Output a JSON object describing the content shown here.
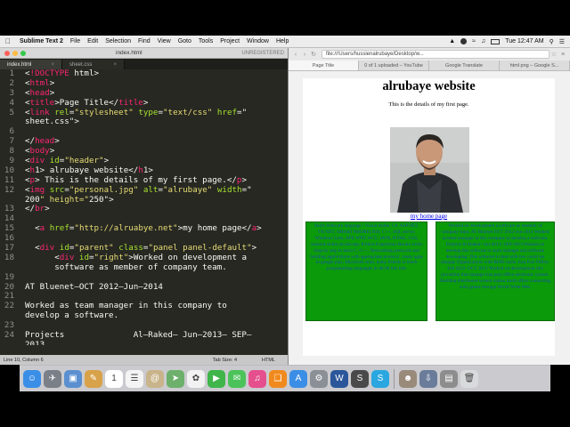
{
  "menubar": {
    "app": "Sublime Text 2",
    "menus": [
      "File",
      "Edit",
      "Selection",
      "Find",
      "View",
      "Goto",
      "Tools",
      "Project",
      "Window",
      "Help"
    ],
    "clock": "Tue 12:47 AM"
  },
  "sublime": {
    "window_title": "index.html",
    "unregistered": "UNREGISTERED",
    "tabs": [
      {
        "label": "index.html",
        "active": true
      },
      {
        "label": "sheet.css",
        "active": false
      }
    ],
    "status_left": "Line 10, Column 6",
    "tab_size": "Tab Size: 4",
    "syntax": "HTML"
  },
  "code": {
    "lines": [
      {
        "n": "1",
        "t": "<!DOCTYPE html>"
      },
      {
        "n": "2",
        "t": "<html>"
      },
      {
        "n": "3",
        "t": "<head>"
      },
      {
        "n": "4",
        "t": "<title>Page Title</title>"
      },
      {
        "n": "5",
        "t": "<link rel=\"stylesheet\" type=\"text/css\" href=\""
      },
      {
        "n": "",
        "t": "sheet.css\">"
      },
      {
        "n": "6",
        "t": ""
      },
      {
        "n": "7",
        "t": "</head>"
      },
      {
        "n": "8",
        "t": "<body>"
      },
      {
        "n": "9",
        "t": "<div id=\"header\">"
      },
      {
        "n": "10",
        "t": "<h1> alrubaye website</h1>"
      },
      {
        "n": "11",
        "t": "<p> This is the details of my first page.</p>"
      },
      {
        "n": "12",
        "t": "<img src=\"personal.jpg\" alt=\"alrubaye\" width=\""
      },
      {
        "n": "",
        "t": "200\" height=\"250\">"
      },
      {
        "n": "13",
        "t": "</br>"
      },
      {
        "n": "14",
        "t": ""
      },
      {
        "n": "15",
        "t": "  <a href=\"http://alruabye.net\">my home page</a>"
      },
      {
        "n": "16",
        "t": ""
      },
      {
        "n": "17",
        "t": "  <div id=\"parent\" class=\"panel panel-default\">"
      },
      {
        "n": "18",
        "t": "      <div id=\"right\">Worked on development a"
      },
      {
        "n": "",
        "t": "      software as member of company team."
      },
      {
        "n": "19",
        "t": ""
      },
      {
        "n": "20",
        "t": "AT Bluenet–OCT 2012–Jun–2014"
      },
      {
        "n": "21",
        "t": ""
      },
      {
        "n": "22",
        "t": "Worked as team manager in this company to"
      },
      {
        "n": "",
        "t": "develop a software."
      },
      {
        "n": "23",
        "t": ""
      },
      {
        "n": "24",
        "t": "Projects              Al–Raked– Jun–2013– SEP–"
      },
      {
        "n": "",
        "t": "2013"
      }
    ]
  },
  "browser": {
    "url": "file:///Users/hussienalrubaye/Desktop/w...",
    "tabs": [
      "Page Title",
      "0 of 1 uploaded – YouTube",
      "Google Translate",
      "html png – Google S..."
    ],
    "page": {
      "h1": "alrubaye website",
      "p": "This is the details of my first page.",
      "link": "my home page",
      "left_panel": "Skills Software language : Visual studio, C#, ASP.NET, VB.NET, SMART PHONE( IOS, C++, SQL server, Windows form, APP, WPF, WCF, JAVA, HTML, CSS, android studio,JavaScript, Python Experience Books wrote Step-by step to learn C, C++, Networking protocols and building applications with appropriate protocol , many apps in google play, Microsoft store, many friends to teach programming languages in 48-96 this link",
      "right_panel": "Worked on development a software as member of company team. AT Bluenet-OCT 2012-Jun-2014 Worked as team manager in this company to develop a software. Projects Al-Raked- Jun-2013- SEP-2013 Worked on develop this software to store manager and software developing. This software is deal with low could we manage Organizations with RFID cards. Iraq Post Office- Feb 2012- OCT 2012 Worked on development this procedure that manage Iraq post office electronic system. Building distributed system makes multi office connecting with gather through World Wide Web."
    }
  },
  "dock": {
    "items": [
      {
        "icon": "finder-icon",
        "color": "#3a8ee6"
      },
      {
        "icon": "launchpad-icon",
        "color": "#7a7f88"
      },
      {
        "icon": "preview-icon",
        "color": "#5b8fd0"
      },
      {
        "icon": "notes-icon",
        "color": "#d8a24a"
      },
      {
        "icon": "calendar-icon",
        "color": "#ffffff"
      },
      {
        "icon": "reminders-icon",
        "color": "#f4f4f4"
      },
      {
        "icon": "contacts-icon",
        "color": "#c9b38a"
      },
      {
        "icon": "maps-icon",
        "color": "#6db06b"
      },
      {
        "icon": "photos-icon",
        "color": "#f2f2f2"
      },
      {
        "icon": "facetime-icon",
        "color": "#3fb54a"
      },
      {
        "icon": "messages-icon",
        "color": "#4bc35a"
      },
      {
        "icon": "itunes-icon",
        "color": "#e54f8d"
      },
      {
        "icon": "ibooks-icon",
        "color": "#f18a1e"
      },
      {
        "icon": "appstore-icon",
        "color": "#3a8ee6"
      },
      {
        "icon": "system-preferences-icon",
        "color": "#8b8f96"
      },
      {
        "icon": "word-icon",
        "color": "#2b579a"
      },
      {
        "icon": "sublime-icon",
        "color": "#4a4a4a"
      },
      {
        "icon": "skype-icon",
        "color": "#2aa7e0"
      },
      {
        "icon": "photo-user-icon",
        "color": "#9a8a7a"
      },
      {
        "icon": "downloads-icon",
        "color": "#6a7c9a"
      },
      {
        "icon": "documents-icon",
        "color": "#8d8d8d"
      },
      {
        "icon": "trash-icon",
        "color": "#d9dadc"
      }
    ]
  }
}
